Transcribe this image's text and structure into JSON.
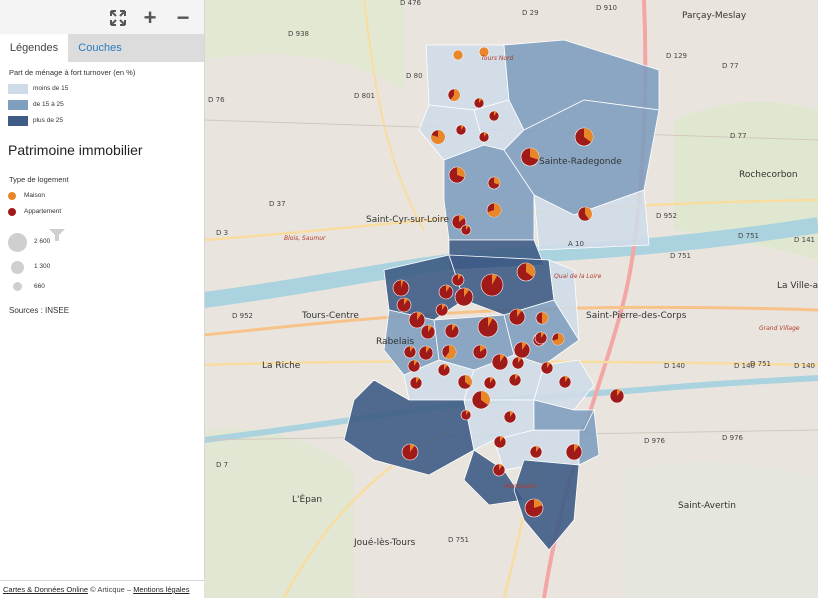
{
  "toolbar": {
    "fullscreen_icon": "expand-icon",
    "zoom_in_label": "+",
    "zoom_out_label": "−"
  },
  "tabs": [
    {
      "label": "Légendes"
    },
    {
      "label": "Couches"
    }
  ],
  "legend": {
    "turnover_title": "Part de ménage à fort turnover (en %)",
    "classes": [
      {
        "label": "moins de 15",
        "color": "#cfdbe8"
      },
      {
        "label": "de 15 à 25",
        "color": "#7f9fbf"
      },
      {
        "label": "plus de 25",
        "color": "#3e5c85"
      }
    ],
    "patrimoine_title": "Patrimoine immobilier",
    "housing_type_title": "Type de logement",
    "housing_types": [
      {
        "label": "Maison",
        "color": "#e8862a"
      },
      {
        "label": "Appartement",
        "color": "#a11a1a"
      }
    ],
    "size_values": [
      "2 600",
      "1 300",
      "660"
    ],
    "sources": "Sources : INSEE"
  },
  "footer": {
    "link1": "Cartes & Données Online",
    "middle": " © Articque – ",
    "link2": "Mentions légales"
  },
  "map": {
    "places": [
      "Parçay-Meslay",
      "Rochecorbon",
      "Saint-Cyr-sur-Loire",
      "Sainte-Radegonde",
      "Saint-Pierre-des-Corps",
      "La Ville-aux-Dames",
      "La Riche",
      "Saint-Avertin",
      "Joué-lès-Tours",
      "L'Épan",
      "Tours Nord",
      "Blois, Saumur",
      "Rabelais",
      "Quai de la Loire",
      "Tours-Centre",
      "Grand Village",
      "Montbazon"
    ],
    "roads": [
      "D 476",
      "D 29",
      "D 910",
      "D 938",
      "D 129",
      "D 80",
      "D 801",
      "D 77",
      "D 76",
      "D 77",
      "D 37",
      "D 952",
      "D 3",
      "D 751",
      "D 141",
      "D 952",
      "D 751",
      "D 751",
      "D 140",
      "D 140",
      "D 140",
      "D 976",
      "D 976",
      "D 7",
      "D 751",
      "A 10"
    ]
  }
}
